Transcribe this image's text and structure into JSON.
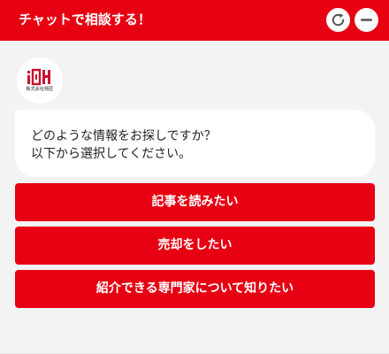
{
  "header": {
    "title": "チャットで相談する！",
    "refresh_icon": "refresh-icon",
    "minimize_icon": "minimize-icon"
  },
  "avatar": {
    "logo_caption": "株式会社翔匠"
  },
  "message": {
    "line1": "どのような情報をお探しですか？",
    "line2": "以下から選択してください。"
  },
  "choices": [
    {
      "label": "記事を読みたい"
    },
    {
      "label": "売却をしたい"
    },
    {
      "label": "紹介できる専門家について知りたい"
    }
  ],
  "colors": {
    "brand_red": "#e60012",
    "background": "#f3f3f3",
    "bubble": "#ffffff",
    "text": "#222222"
  }
}
